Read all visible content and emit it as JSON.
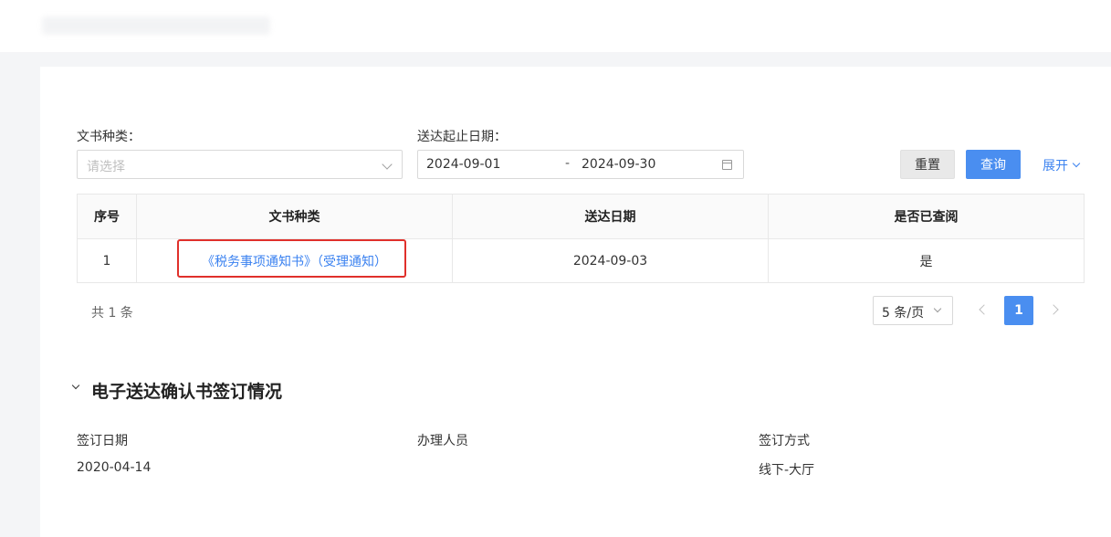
{
  "filters": {
    "doc_type_label": "文书种类：",
    "doc_type_placeholder": "请选择",
    "date_range_label": "送达起止日期：",
    "date_start": "2024-09-01",
    "date_separator": "-",
    "date_end": "2024-09-30",
    "reset_label": "重置",
    "query_label": "查询",
    "expand_label": "展开"
  },
  "table": {
    "headers": [
      "序号",
      "文书种类",
      "送达日期",
      "是否已查阅"
    ],
    "rows": [
      [
        "1",
        "《税务事项通知书》（受理通知）",
        "2024-09-03",
        "是"
      ]
    ]
  },
  "pagination": {
    "total_text": "共 1 条",
    "page_size": "5 条/页",
    "current_page": "1"
  },
  "section": {
    "title": "电子送达确认书签订情况",
    "fields": [
      {
        "label": "签订日期",
        "value": "2020-04-14"
      },
      {
        "label": "办理人员",
        "value": ""
      },
      {
        "label": "签订方式",
        "value": "线下-大厅"
      }
    ]
  },
  "colors": {
    "primary": "#4a8ef0",
    "link": "#3b82f0",
    "highlight": "#e0302b"
  }
}
